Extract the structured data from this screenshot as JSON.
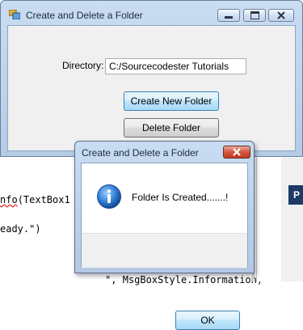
{
  "background_editor": {
    "line1": {
      "before": "",
      "error_text": "nfo",
      "after": "(TextBox1"
    },
    "line2": "eady.\")",
    "line3": "                  \", MsgBoxStyle.Information)",
    "panel_letter": "P"
  },
  "main_window": {
    "title": "Create and Delete a Folder",
    "directory_label": "Directory:",
    "directory_value": "C:/Sourcecodester Tutorials",
    "create_button": "Create New Folder",
    "delete_button": "Delete Folder"
  },
  "message_box": {
    "title": "Create and Delete a Folder",
    "message": "Folder Is Created.......!",
    "ok_button": "OK",
    "icon": "information-icon"
  },
  "colors": {
    "titlebar": "#c9dcf2",
    "client": "#f0f0f0",
    "close_red": "#c23b22",
    "info_blue": "#1a5fb4"
  }
}
